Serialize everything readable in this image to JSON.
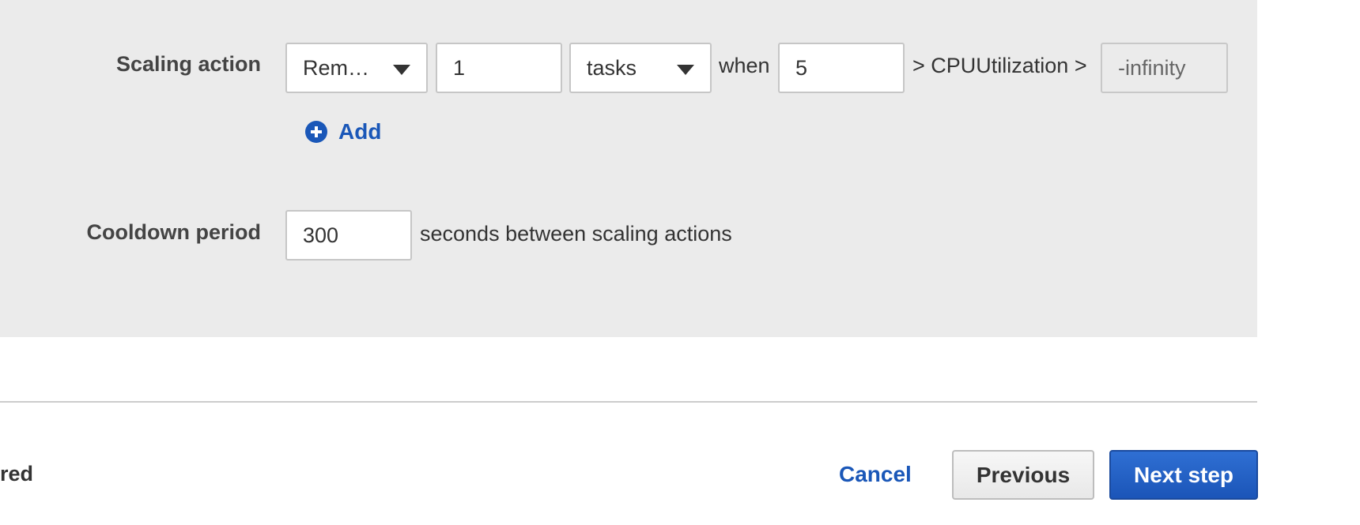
{
  "scaling_action": {
    "label": "Scaling action",
    "operation_select": "Rem…",
    "amount_value": "1",
    "unit_select": "tasks",
    "when_text": "when",
    "threshold_value": "5",
    "metric_text": "> CPUUtilization >",
    "lower_bound_value": "-infinity",
    "add_label": "Add"
  },
  "cooldown": {
    "label": "Cooldown period",
    "value": "300",
    "suffix": "seconds between scaling actions"
  },
  "footer": {
    "left_text": "red",
    "cancel_label": "Cancel",
    "previous_label": "Previous",
    "next_label": "Next step"
  },
  "colors": {
    "link": "#1a57b8",
    "primary_button": "#1b55b8",
    "panel_background": "#ebebeb"
  }
}
